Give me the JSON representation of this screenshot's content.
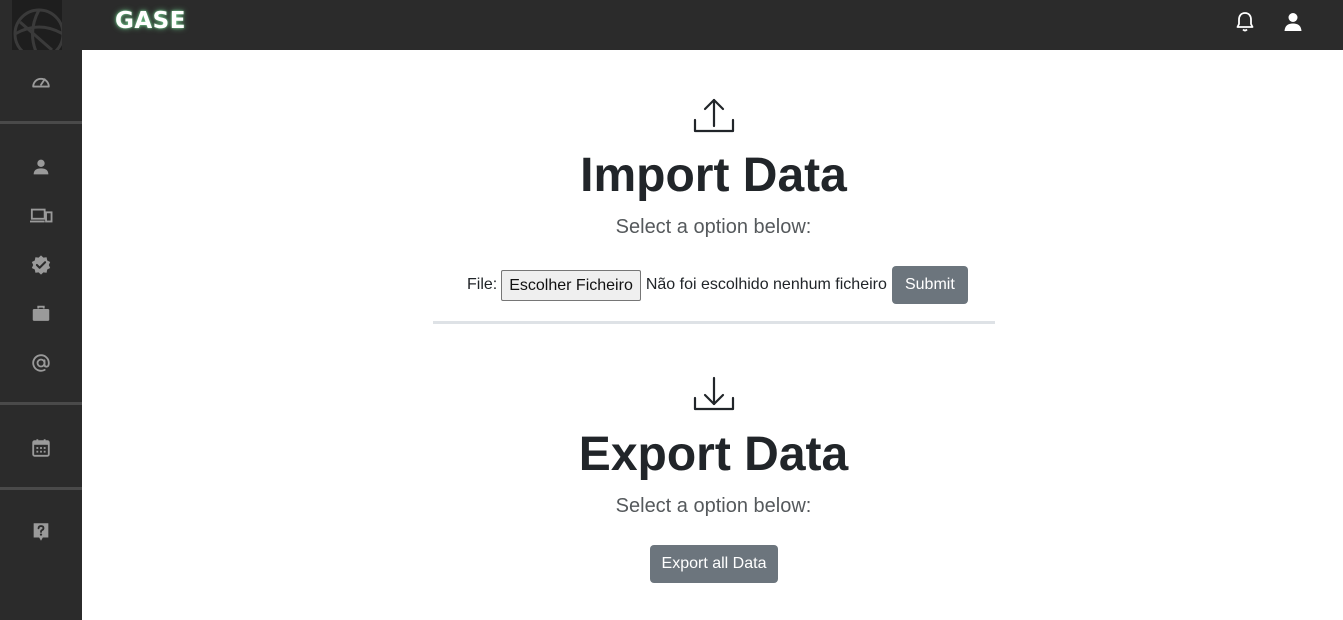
{
  "header": {
    "brand": "GASE"
  },
  "import": {
    "title": "Import Data",
    "subtitle": "Select a option below:",
    "file_label": "File:",
    "choose_file_label": "Escolher Ficheiro",
    "no_file_text": "Não foi escolhido nenhum ficheiro",
    "submit_label": "Submit"
  },
  "export": {
    "title": "Export Data",
    "subtitle": "Select a option below:",
    "export_all_label": "Export all Data"
  },
  "icons": {
    "notification": "bell-icon",
    "user": "user-icon",
    "dashboard": "speedometer-icon",
    "people": "person-icon",
    "devices": "devices-icon",
    "verified": "verified-badge-icon",
    "work": "briefcase-icon",
    "mail": "at-sign-icon",
    "calendar": "calendar-icon",
    "help": "help-icon",
    "upload": "upload-icon",
    "download": "download-icon"
  },
  "colors": {
    "topbar": "#2b2b2b",
    "sidebar": "#2b2b2b",
    "button": "#6c757d",
    "heading": "#212529",
    "sidebar_icon": "#9a9a9a"
  }
}
